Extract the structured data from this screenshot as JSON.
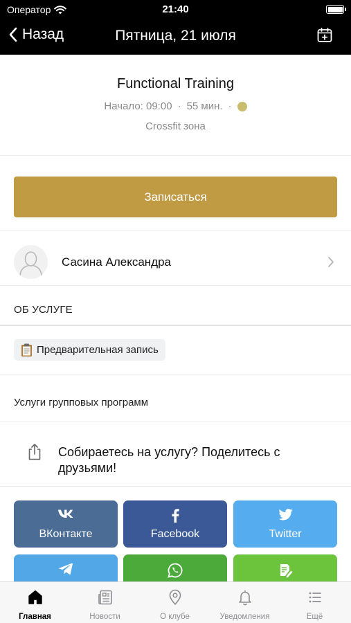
{
  "status_bar": {
    "carrier": "Оператор",
    "time": "21:40"
  },
  "nav": {
    "back_label": "Назад",
    "title": "Пятница, 21 июля"
  },
  "service": {
    "title": "Functional Training",
    "start": "Начало: 09:00",
    "duration": "55 мин.",
    "separator": "·",
    "location": "Crossfit зона",
    "dot_color": "#c9bd6d"
  },
  "signup_label": "Записаться",
  "trainer": {
    "name": "Сасина Александра"
  },
  "about": {
    "heading": "ОБ УСЛУГЕ",
    "tag": "Предварительная запись",
    "programs": "Услуги групповых программ"
  },
  "share": {
    "text": "Собираетесь на услугу? Поделитесь с друзьями!"
  },
  "social": [
    {
      "label": "ВКонтакте",
      "icon": "vk-icon",
      "color": "#4a6c95"
    },
    {
      "label": "Facebook",
      "icon": "facebook-icon",
      "color": "#3b5997"
    },
    {
      "label": "Twitter",
      "icon": "twitter-icon",
      "color": "#55acee"
    },
    {
      "label": "",
      "icon": "telegram-icon",
      "color": "#52a8e6"
    },
    {
      "label": "",
      "icon": "whatsapp-icon",
      "color": "#4caa3b"
    },
    {
      "label": "",
      "icon": "note-icon",
      "color": "#6bc43c"
    }
  ],
  "tabs": [
    {
      "label": "Главная",
      "icon": "home-icon",
      "active": true
    },
    {
      "label": "Новости",
      "icon": "news-icon"
    },
    {
      "label": "О клубе",
      "icon": "location-pin-icon"
    },
    {
      "label": "Уведомления",
      "icon": "bell-icon"
    },
    {
      "label": "Ещё",
      "icon": "list-icon"
    }
  ],
  "colors": {
    "accent": "#c19a44",
    "header_bg": "#000000"
  }
}
